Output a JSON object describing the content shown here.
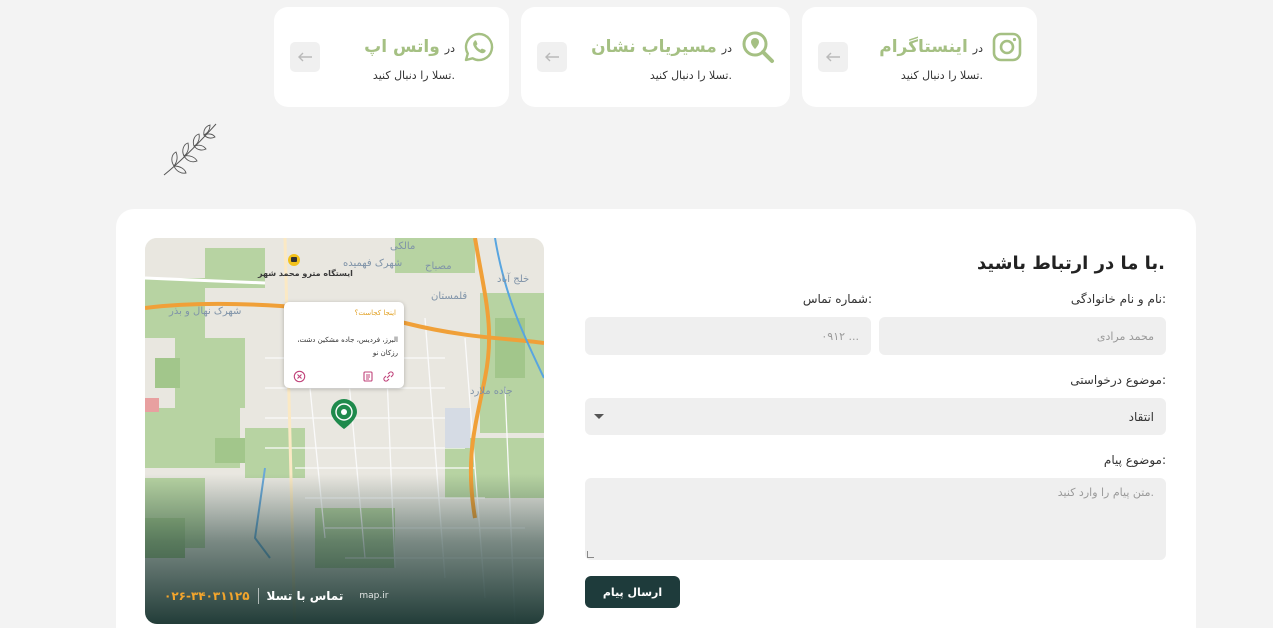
{
  "social_cards": {
    "instagram": {
      "prefix": "در",
      "brand": "اینستاگرام",
      "subtitle": "تسلا را دنبال کنید."
    },
    "neshan": {
      "prefix": "در",
      "brand": "مسیریاب نشان",
      "subtitle": "تسلا را دنبال کنید."
    },
    "whatsapp": {
      "prefix": "در",
      "brand": "واتس اپ",
      "subtitle": "تسلا را دنبال کنید."
    }
  },
  "contact_form": {
    "title": "با ما در ارتباط باشید.",
    "name_label": "نام و نام خانوادگی:",
    "name_placeholder": "محمد مرادی",
    "phone_label": "شماره تماس:",
    "phone_placeholder": "۰۹۱۲ ...",
    "subject_label": "موضوع درخواستی:",
    "subject_value": "انتقاد",
    "message_label": "موضوع پیام:",
    "message_placeholder": "متن پیام را وارد کنید.",
    "submit_label": "ارسال پیام"
  },
  "map": {
    "metro_label": "ایستگاه مترو محمد شهر",
    "places": [
      "شهرک فهمیده",
      "مصباح",
      "قلمستان",
      "شهرک نهال و بذر",
      "جاده ملارد",
      "خلج آباد",
      "مالکی"
    ],
    "popup_title": "اینجا کجاست؟",
    "popup_address": "البرز، فردیس، جاده مشکین دشت، رزکان نو",
    "footer_phone": "۰۲۶-۳۴۰۳۱۱۲۵",
    "footer_contact": "تماس با تسلا",
    "footer_credit": "map.ir"
  },
  "colors": {
    "brand_green": "#a5c083",
    "button_dark": "#1e3b3b",
    "phone_orange": "#f3a52c"
  },
  "icons": [
    "instagram-icon",
    "neshan-search-icon",
    "whatsapp-icon",
    "arrow-left-icon",
    "leaf-sprig-icon",
    "metro-icon",
    "location-pin-icon",
    "link-icon",
    "copy-icon",
    "close-circle-icon",
    "select-caret-icon"
  ]
}
